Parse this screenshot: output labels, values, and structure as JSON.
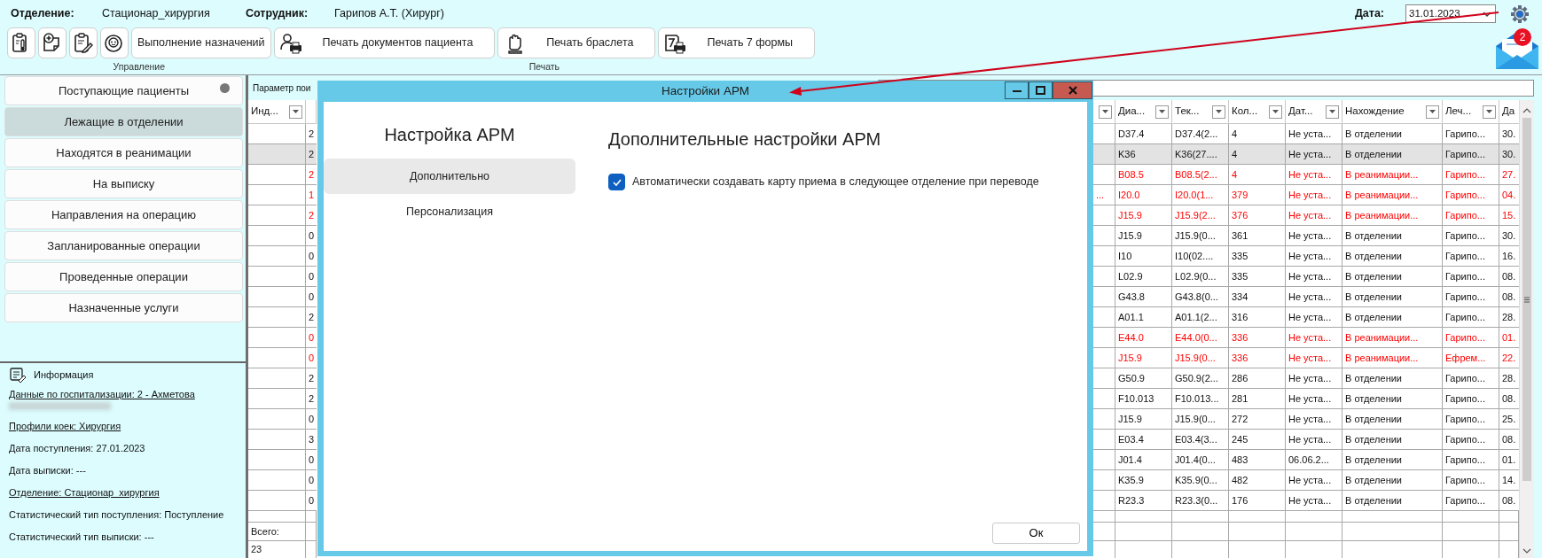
{
  "header": {
    "department_label": "Отделение:",
    "department": "Стационар_хирургия",
    "employee_label": "Сотрудник:",
    "employee": "Гарипов А.Т. (Хирург)",
    "date_label": "Дата:",
    "date": "31.01.2023"
  },
  "notifications": {
    "count": "2"
  },
  "toolbar": [
    {
      "label": "Управление",
      "buttons": [
        {
          "kind": "icon"
        },
        {
          "kind": "icon"
        },
        {
          "kind": "icon"
        },
        {
          "kind": "icon"
        },
        {
          "kind": "text",
          "label": "Выполнение назначений"
        }
      ]
    },
    {
      "label": "Печать",
      "buttons": [
        {
          "kind": "icon-text",
          "label": "Печать документов пациента"
        },
        {
          "kind": "icon-text",
          "label": "Печать браслета"
        },
        {
          "kind": "icon-text",
          "label": "Печать 7 формы"
        }
      ]
    }
  ],
  "sidebar": {
    "items": [
      {
        "label": "Поступающие пациенты",
        "selected": false,
        "indicator": true
      },
      {
        "label": "Лежащие в отделении",
        "selected": true,
        "indicator": false
      },
      {
        "label": "Находятся в реанимации",
        "selected": false,
        "indicator": false
      },
      {
        "label": "На выписку",
        "selected": false,
        "indicator": false
      },
      {
        "label": "Направления на операцию",
        "selected": false,
        "indicator": false
      },
      {
        "label": "Запланированные операции",
        "selected": false,
        "indicator": false
      },
      {
        "label": "Проведенные операции",
        "selected": false,
        "indicator": false
      },
      {
        "label": "Назначенные услуги",
        "selected": false,
        "indicator": false
      }
    ]
  },
  "info": {
    "title": "Информация",
    "items": [
      {
        "kind": "link",
        "text": "Данные по госпитализации: 2 - Ахметова"
      },
      {
        "kind": "redacted"
      },
      {
        "kind": "link",
        "text": "Профили коек: Хирургия"
      },
      {
        "kind": "text",
        "text": "Дата поступления: 27.01.2023"
      },
      {
        "kind": "text",
        "text": "Дата выписки: ---"
      },
      {
        "kind": "link",
        "text": "Отделение: Стационар_хирургия"
      },
      {
        "kind": "text",
        "text": "Статистический тип поступления: Поступление"
      },
      {
        "kind": "text",
        "text": "Статистический тип выписки: ---"
      }
    ]
  },
  "search": {
    "label": "Параметр пои"
  },
  "table": {
    "index_column": {
      "label": "Инд..."
    },
    "columns": [
      {
        "label": "Диа..."
      },
      {
        "label": "Тек..."
      },
      {
        "label": "Кол..."
      },
      {
        "label": "Дат..."
      },
      {
        "label": "Нахождение"
      },
      {
        "label": "Леч..."
      },
      {
        "label": "Да"
      }
    ],
    "rows": [
      {
        "selected": false,
        "alert": false,
        "column_2": "2",
        "cells": [
          "D37.4",
          "D37.4(2...",
          "4",
          "Не уста...",
          "В отделении",
          "Гарипо...",
          "30."
        ]
      },
      {
        "selected": true,
        "alert": false,
        "column_2": "2",
        "cells": [
          "K36",
          "K36(27....",
          "4",
          "Не уста...",
          "В отделении",
          "Гарипо...",
          "30."
        ]
      },
      {
        "selected": false,
        "alert": true,
        "column_2": "2",
        "cells": [
          "B08.5",
          "B08.5(2...",
          "4",
          "Не уста...",
          "В реанимации...",
          "Гарипо...",
          "27."
        ]
      },
      {
        "selected": false,
        "alert": true,
        "column_2": "1",
        "column_3": "...",
        "cells": [
          "I20.0",
          "I20.0(1...",
          "379",
          "Не уста...",
          "В реанимации...",
          "Гарипо...",
          "04."
        ]
      },
      {
        "selected": false,
        "alert": true,
        "column_2": "2",
        "cells": [
          "J15.9",
          "J15.9(2...",
          "376",
          "Не уста...",
          "В реанимации...",
          "Гарипо...",
          "15."
        ]
      },
      {
        "selected": false,
        "alert": false,
        "column_2": "0",
        "cells": [
          "J15.9",
          "J15.9(0...",
          "361",
          "Не уста...",
          "В отделении",
          "Гарипо...",
          "30."
        ]
      },
      {
        "selected": false,
        "alert": false,
        "column_2": "0",
        "cells": [
          "I10",
          "I10(02....",
          "335",
          "Не уста...",
          "В отделении",
          "Гарипо...",
          "16."
        ]
      },
      {
        "selected": false,
        "alert": false,
        "column_2": "0",
        "cells": [
          "L02.9",
          "L02.9(0...",
          "335",
          "Не уста...",
          "В отделении",
          "Гарипо...",
          "08."
        ]
      },
      {
        "selected": false,
        "alert": false,
        "column_2": "0",
        "cells": [
          "G43.8",
          "G43.8(0...",
          "334",
          "Не уста...",
          "В отделении",
          "Гарипо...",
          "08."
        ]
      },
      {
        "selected": false,
        "alert": false,
        "column_2": "2",
        "cells": [
          "A01.1",
          "A01.1(2...",
          "316",
          "Не уста...",
          "В отделении",
          "Гарипо...",
          "28."
        ]
      },
      {
        "selected": false,
        "alert": true,
        "column_2": "0",
        "cells": [
          "E44.0",
          "E44.0(0...",
          "336",
          "Не уста...",
          "В реанимации...",
          "Гарипо...",
          "01."
        ]
      },
      {
        "selected": false,
        "alert": true,
        "column_2": "0",
        "cells": [
          "J15.9",
          "J15.9(0...",
          "336",
          "Не уста...",
          "В реанимации...",
          "Ефрем...",
          "22."
        ]
      },
      {
        "selected": false,
        "alert": false,
        "column_2": "2",
        "cells": [
          "G50.9",
          "G50.9(2...",
          "286",
          "Не уста...",
          "В отделении",
          "Гарипо...",
          "28."
        ]
      },
      {
        "selected": false,
        "alert": false,
        "column_2": "2",
        "cells": [
          "F10.013",
          "F10.013...",
          "281",
          "Не уста...",
          "В отделении",
          "Гарипо...",
          "08."
        ]
      },
      {
        "selected": false,
        "alert": false,
        "column_2": "0",
        "cells": [
          "J15.9",
          "J15.9(0...",
          "272",
          "Не уста...",
          "В отделении",
          "Гарипо...",
          "25."
        ]
      },
      {
        "selected": false,
        "alert": false,
        "column_2": "3",
        "cells": [
          "E03.4",
          "E03.4(3...",
          "245",
          "Не уста...",
          "В отделении",
          "Гарипо...",
          "08."
        ]
      },
      {
        "selected": false,
        "alert": false,
        "column_2": "0",
        "cells": [
          "J01.4",
          "J01.4(0...",
          "483",
          "06.06.2...",
          "В отделении",
          "Гарипо...",
          "01."
        ]
      },
      {
        "selected": false,
        "alert": false,
        "column_2": "0",
        "cells": [
          "K35.9",
          "K35.9(0...",
          "482",
          "Не уста...",
          "В отделении",
          "Гарипо...",
          "14."
        ]
      },
      {
        "selected": false,
        "alert": false,
        "column_2": "0",
        "cells": [
          "R23.3",
          "R23.3(0...",
          "176",
          "Не уста...",
          "В отделении",
          "Гарипо...",
          "08."
        ]
      }
    ],
    "total_label": "Всего:",
    "total": "23"
  },
  "dialog": {
    "title": "Настройки АРМ",
    "nav_title": "Настройка АРМ",
    "nav": [
      {
        "label": "Дополнительно",
        "selected": true
      },
      {
        "label": "Персонализация",
        "selected": false
      }
    ],
    "heading": "Дополнительные настройки АРМ",
    "options": [
      {
        "label": "Автоматически создавать карту приема в следующее отделение при переводе",
        "checked": true
      }
    ],
    "ok": "Ок"
  }
}
